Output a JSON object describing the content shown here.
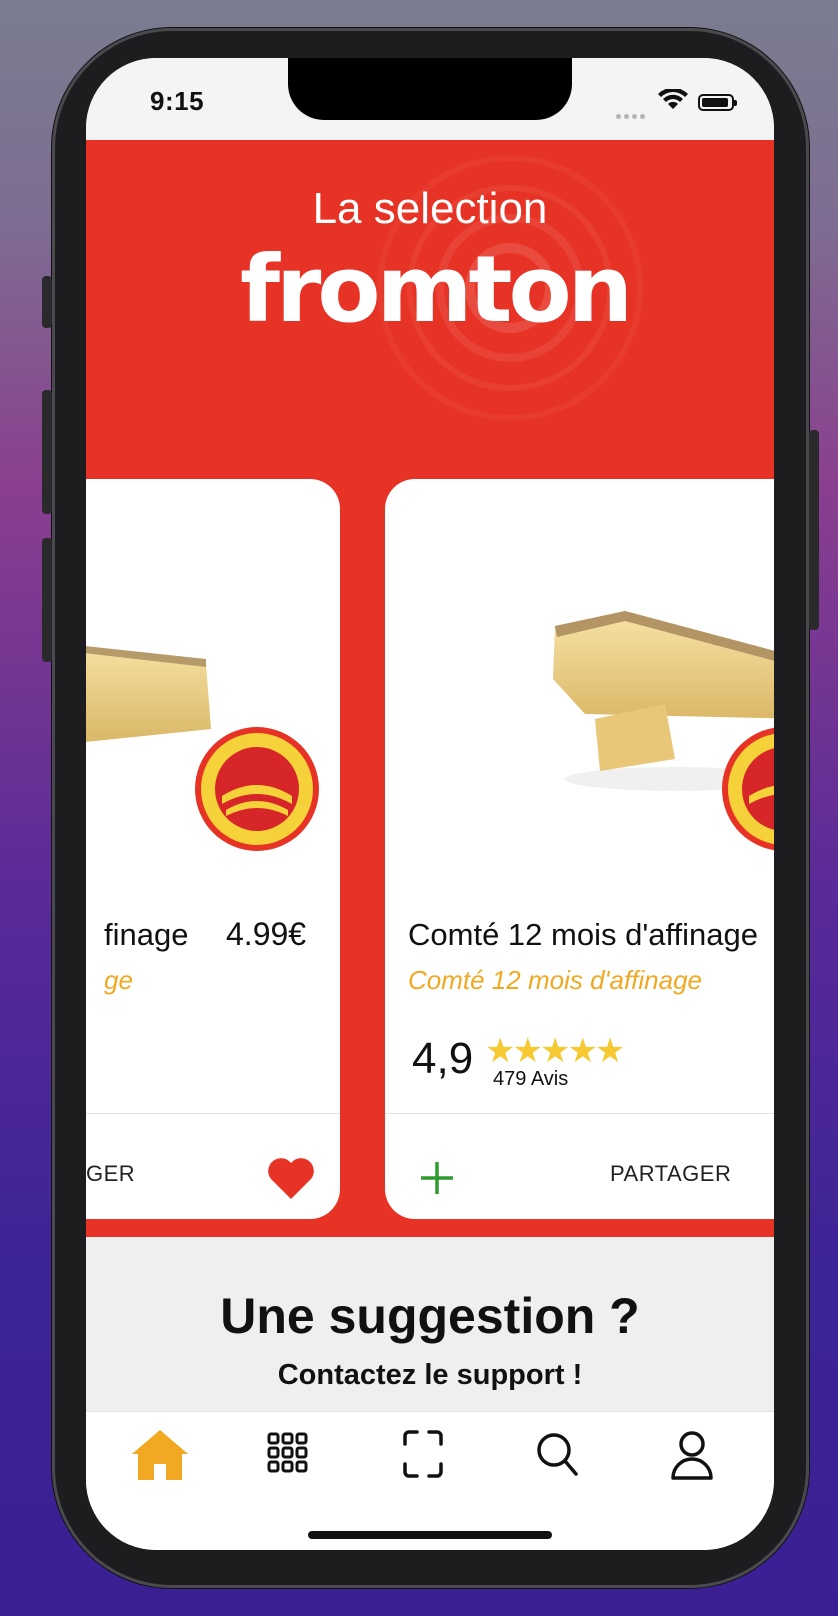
{
  "status_bar": {
    "time": "9:15"
  },
  "header": {
    "title": "La selection",
    "logo_text": "fromton"
  },
  "colors": {
    "brand_red": "#e73325",
    "accent_orange": "#f1a822",
    "star_yellow": "#f6c932",
    "heart_red": "#e73325",
    "plus_green": "#2e9b2e"
  },
  "products": [
    {
      "title": "fina­ge",
      "title_visible": "finage",
      "subtitle_visible": "ge",
      "price": "4.99€",
      "action_visible": "GER",
      "favorite": true
    },
    {
      "title": "Comté 12 mois d'affinage",
      "subtitle": "Comté 12 mois d'affinage",
      "rating": "4,9",
      "stars": "★★★★★",
      "reviews": "479 Avis",
      "add_icon": "plus-icon",
      "share_label": "PARTAGER"
    }
  ],
  "suggestion": {
    "title": "Une suggestion ?",
    "subtitle": "Contactez le support !"
  },
  "tabbar": {
    "items": [
      "home-icon",
      "grid-icon",
      "scan-icon",
      "search-icon",
      "profile-icon"
    ],
    "active": "home-icon"
  }
}
